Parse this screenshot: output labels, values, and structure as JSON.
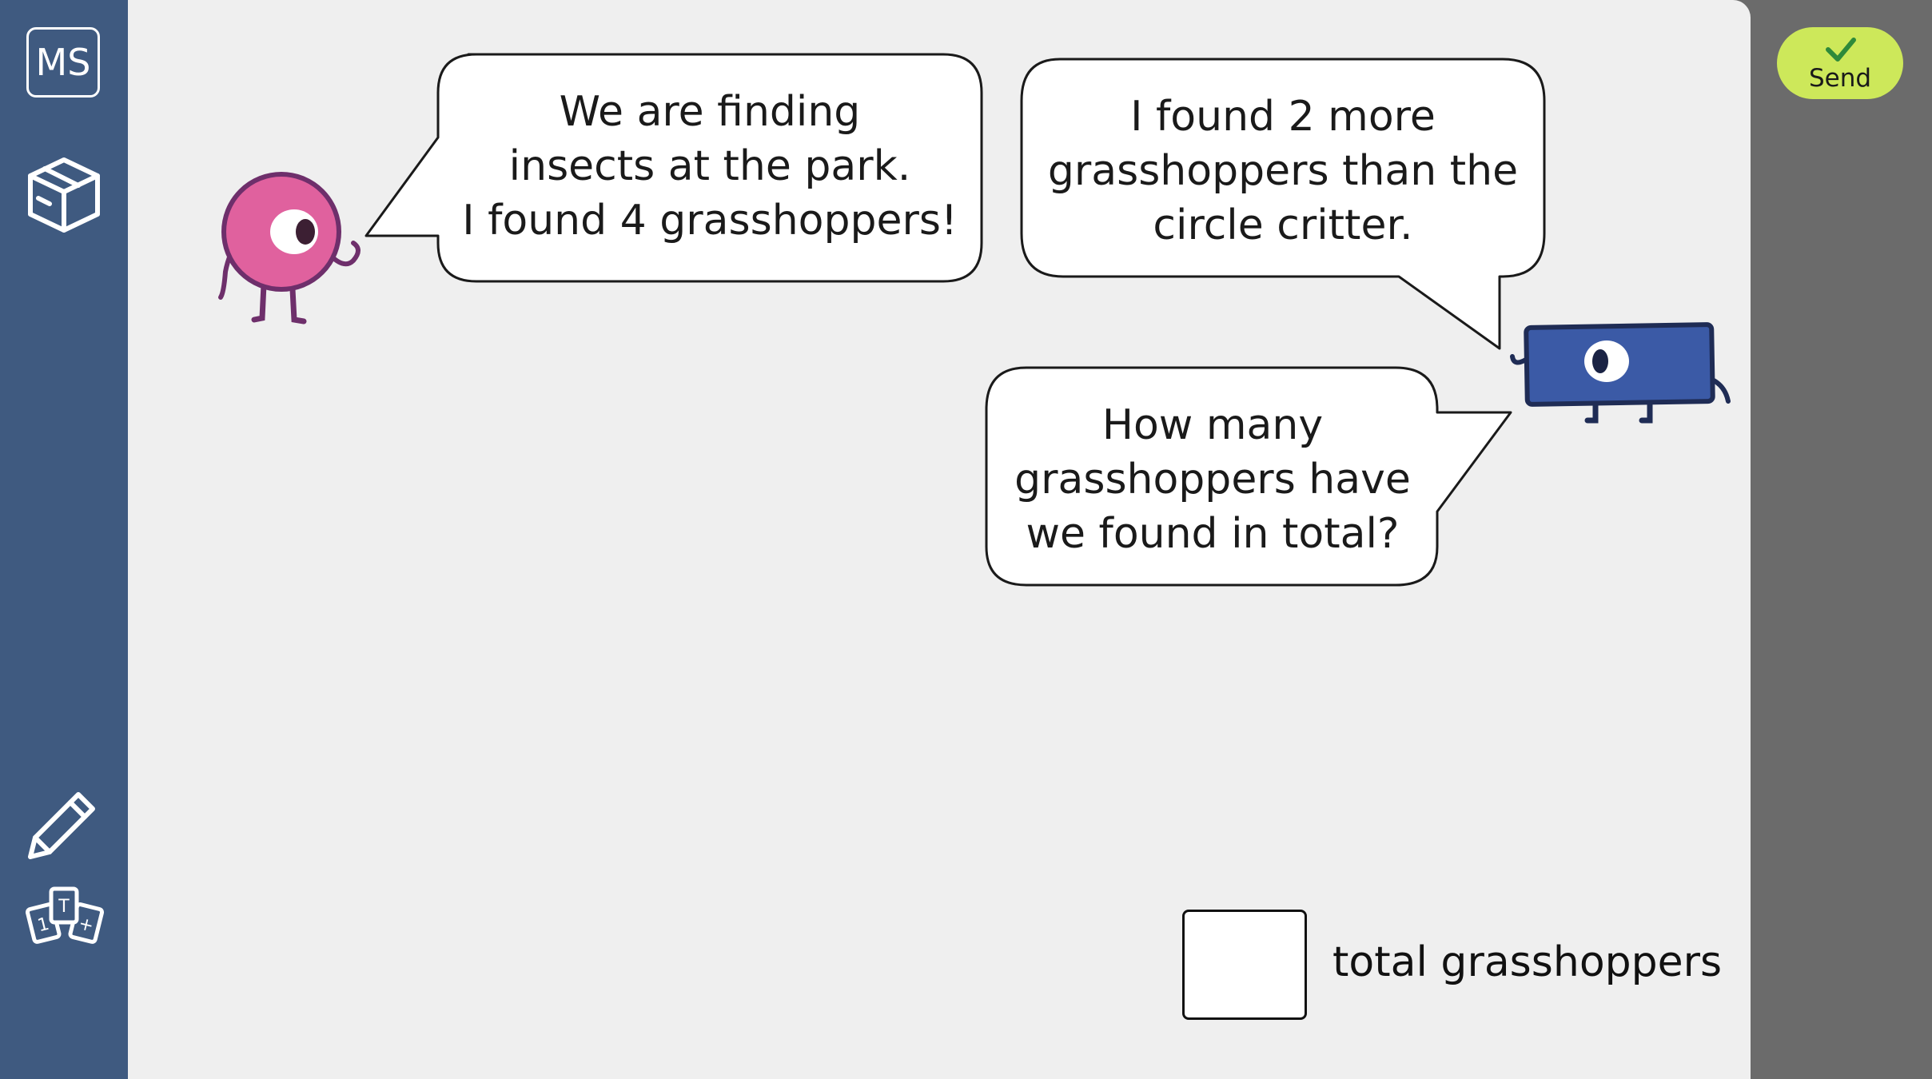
{
  "sidebar": {
    "initials": "MS",
    "icons": [
      "box-icon",
      "pencil-icon",
      "number-cards-icon"
    ],
    "expand_icon": "chevron-right-icon"
  },
  "toolbar": {
    "send_label": "Send",
    "send_icon": "checkmark-icon"
  },
  "dialogue": {
    "circle_critter": "We are finding\ninsects at the park.\nI found 4 grasshoppers!",
    "rectangle_critter": "I found 2 more\ngrasshoppers than the\ncircle critter.",
    "question": "How many\ngrasshoppers have\nwe found in total?"
  },
  "answer": {
    "value": "",
    "label": "total grasshoppers"
  },
  "colors": {
    "sidebar": "#3f5a80",
    "canvas": "#efefef",
    "send_button": "#cde85a",
    "circle_critter": "#e0619e",
    "rectangle_critter": "#3b5aa6"
  }
}
